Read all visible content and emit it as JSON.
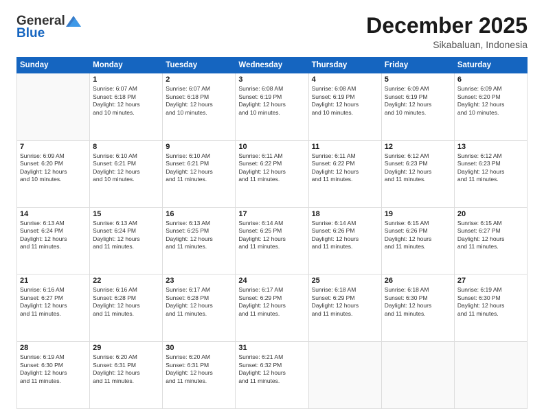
{
  "logo": {
    "general": "General",
    "blue": "Blue"
  },
  "title": "December 2025",
  "location": "Sikabaluan, Indonesia",
  "weekdays": [
    "Sunday",
    "Monday",
    "Tuesday",
    "Wednesday",
    "Thursday",
    "Friday",
    "Saturday"
  ],
  "weeks": [
    [
      {
        "day": "",
        "info": ""
      },
      {
        "day": "1",
        "info": "Sunrise: 6:07 AM\nSunset: 6:18 PM\nDaylight: 12 hours\nand 10 minutes."
      },
      {
        "day": "2",
        "info": "Sunrise: 6:07 AM\nSunset: 6:18 PM\nDaylight: 12 hours\nand 10 minutes."
      },
      {
        "day": "3",
        "info": "Sunrise: 6:08 AM\nSunset: 6:19 PM\nDaylight: 12 hours\nand 10 minutes."
      },
      {
        "day": "4",
        "info": "Sunrise: 6:08 AM\nSunset: 6:19 PM\nDaylight: 12 hours\nand 10 minutes."
      },
      {
        "day": "5",
        "info": "Sunrise: 6:09 AM\nSunset: 6:19 PM\nDaylight: 12 hours\nand 10 minutes."
      },
      {
        "day": "6",
        "info": "Sunrise: 6:09 AM\nSunset: 6:20 PM\nDaylight: 12 hours\nand 10 minutes."
      }
    ],
    [
      {
        "day": "7",
        "info": "Sunrise: 6:09 AM\nSunset: 6:20 PM\nDaylight: 12 hours\nand 10 minutes."
      },
      {
        "day": "8",
        "info": "Sunrise: 6:10 AM\nSunset: 6:21 PM\nDaylight: 12 hours\nand 10 minutes."
      },
      {
        "day": "9",
        "info": "Sunrise: 6:10 AM\nSunset: 6:21 PM\nDaylight: 12 hours\nand 11 minutes."
      },
      {
        "day": "10",
        "info": "Sunrise: 6:11 AM\nSunset: 6:22 PM\nDaylight: 12 hours\nand 11 minutes."
      },
      {
        "day": "11",
        "info": "Sunrise: 6:11 AM\nSunset: 6:22 PM\nDaylight: 12 hours\nand 11 minutes."
      },
      {
        "day": "12",
        "info": "Sunrise: 6:12 AM\nSunset: 6:23 PM\nDaylight: 12 hours\nand 11 minutes."
      },
      {
        "day": "13",
        "info": "Sunrise: 6:12 AM\nSunset: 6:23 PM\nDaylight: 12 hours\nand 11 minutes."
      }
    ],
    [
      {
        "day": "14",
        "info": "Sunrise: 6:13 AM\nSunset: 6:24 PM\nDaylight: 12 hours\nand 11 minutes."
      },
      {
        "day": "15",
        "info": "Sunrise: 6:13 AM\nSunset: 6:24 PM\nDaylight: 12 hours\nand 11 minutes."
      },
      {
        "day": "16",
        "info": "Sunrise: 6:13 AM\nSunset: 6:25 PM\nDaylight: 12 hours\nand 11 minutes."
      },
      {
        "day": "17",
        "info": "Sunrise: 6:14 AM\nSunset: 6:25 PM\nDaylight: 12 hours\nand 11 minutes."
      },
      {
        "day": "18",
        "info": "Sunrise: 6:14 AM\nSunset: 6:26 PM\nDaylight: 12 hours\nand 11 minutes."
      },
      {
        "day": "19",
        "info": "Sunrise: 6:15 AM\nSunset: 6:26 PM\nDaylight: 12 hours\nand 11 minutes."
      },
      {
        "day": "20",
        "info": "Sunrise: 6:15 AM\nSunset: 6:27 PM\nDaylight: 12 hours\nand 11 minutes."
      }
    ],
    [
      {
        "day": "21",
        "info": "Sunrise: 6:16 AM\nSunset: 6:27 PM\nDaylight: 12 hours\nand 11 minutes."
      },
      {
        "day": "22",
        "info": "Sunrise: 6:16 AM\nSunset: 6:28 PM\nDaylight: 12 hours\nand 11 minutes."
      },
      {
        "day": "23",
        "info": "Sunrise: 6:17 AM\nSunset: 6:28 PM\nDaylight: 12 hours\nand 11 minutes."
      },
      {
        "day": "24",
        "info": "Sunrise: 6:17 AM\nSunset: 6:29 PM\nDaylight: 12 hours\nand 11 minutes."
      },
      {
        "day": "25",
        "info": "Sunrise: 6:18 AM\nSunset: 6:29 PM\nDaylight: 12 hours\nand 11 minutes."
      },
      {
        "day": "26",
        "info": "Sunrise: 6:18 AM\nSunset: 6:30 PM\nDaylight: 12 hours\nand 11 minutes."
      },
      {
        "day": "27",
        "info": "Sunrise: 6:19 AM\nSunset: 6:30 PM\nDaylight: 12 hours\nand 11 minutes."
      }
    ],
    [
      {
        "day": "28",
        "info": "Sunrise: 6:19 AM\nSunset: 6:30 PM\nDaylight: 12 hours\nand 11 minutes."
      },
      {
        "day": "29",
        "info": "Sunrise: 6:20 AM\nSunset: 6:31 PM\nDaylight: 12 hours\nand 11 minutes."
      },
      {
        "day": "30",
        "info": "Sunrise: 6:20 AM\nSunset: 6:31 PM\nDaylight: 12 hours\nand 11 minutes."
      },
      {
        "day": "31",
        "info": "Sunrise: 6:21 AM\nSunset: 6:32 PM\nDaylight: 12 hours\nand 11 minutes."
      },
      {
        "day": "",
        "info": ""
      },
      {
        "day": "",
        "info": ""
      },
      {
        "day": "",
        "info": ""
      }
    ]
  ]
}
